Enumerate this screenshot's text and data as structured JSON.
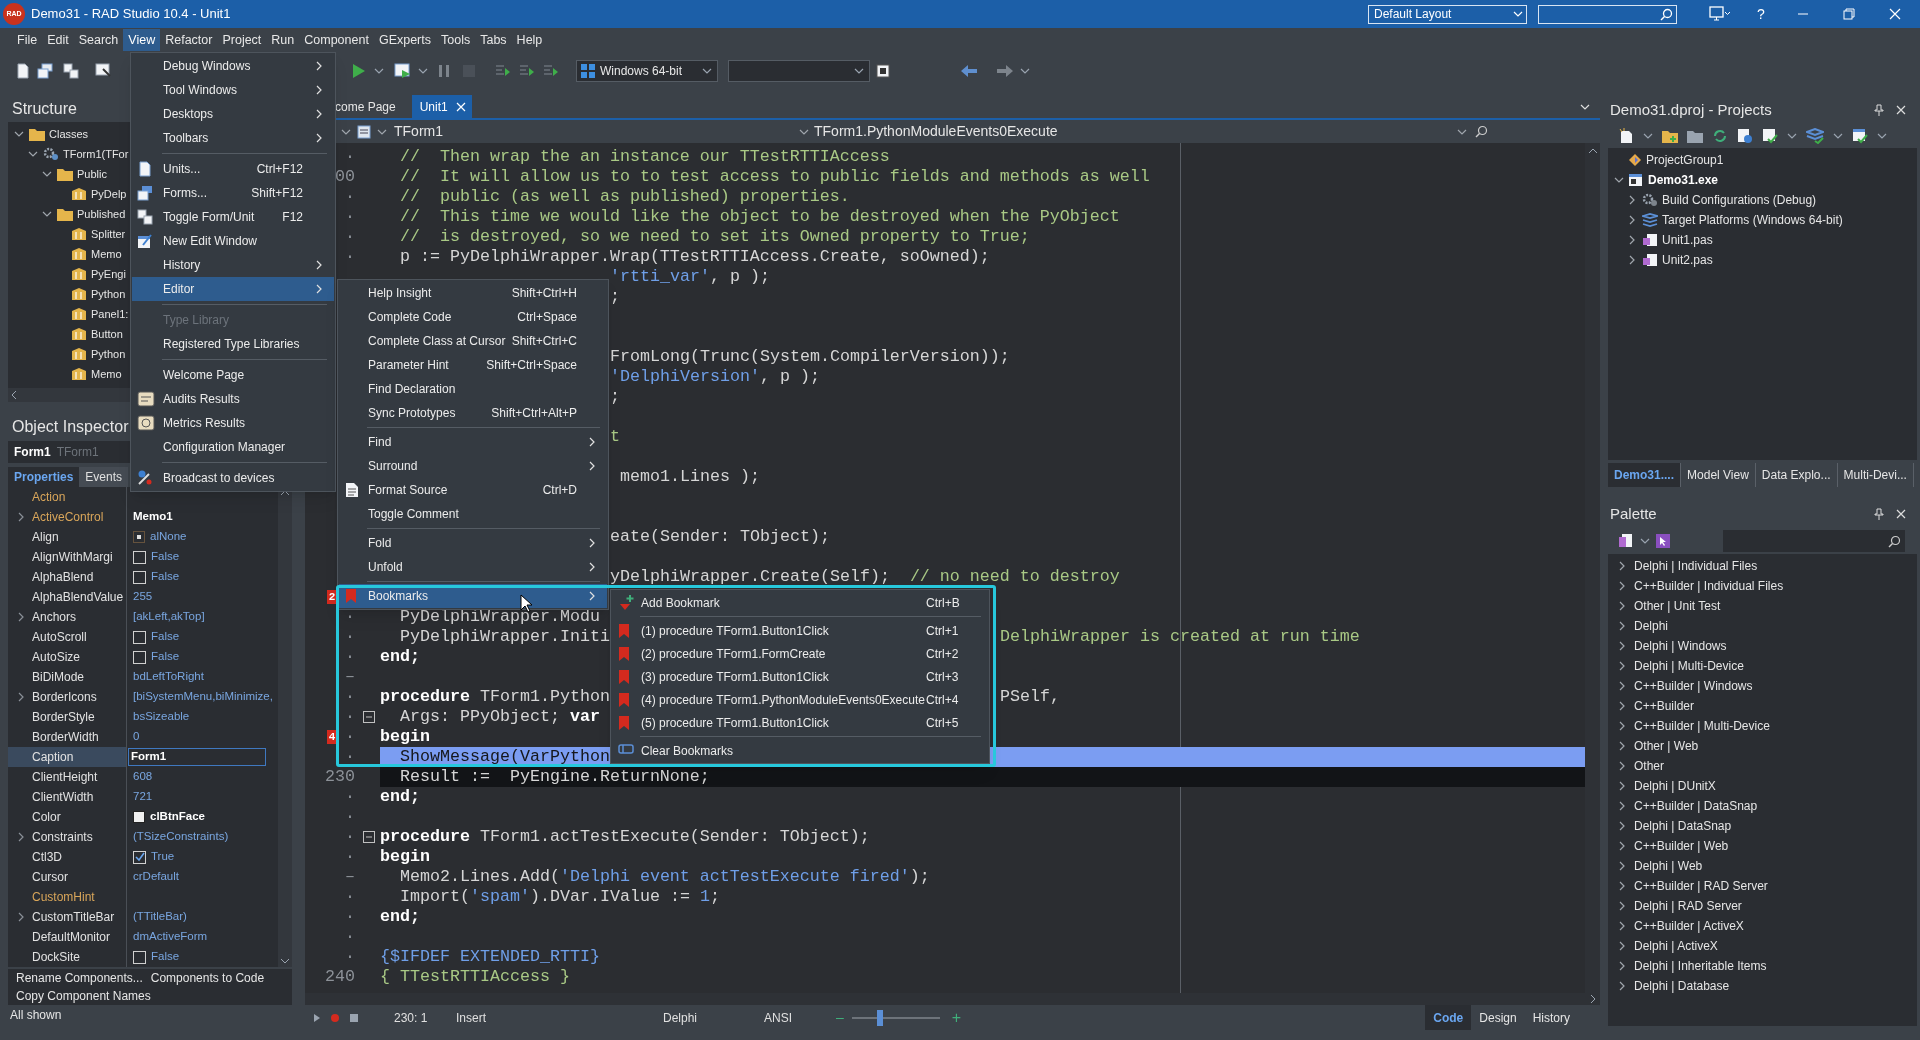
{
  "title_bar": {
    "logo": "RAD",
    "title": "Demo31 - RAD Studio 10.4 - Unit1",
    "layout": "Default Layout",
    "help": "?"
  },
  "menu_bar": [
    {
      "label": "File",
      "selected": false
    },
    {
      "label": "Edit",
      "selected": false
    },
    {
      "label": "Search",
      "selected": false
    },
    {
      "label": "View",
      "selected": true
    },
    {
      "label": "Refactor",
      "selected": false
    },
    {
      "label": "Project",
      "selected": false
    },
    {
      "label": "Run",
      "selected": false
    },
    {
      "label": "Component",
      "selected": false
    },
    {
      "label": "GExperts",
      "selected": false
    },
    {
      "label": "Tools",
      "selected": false
    },
    {
      "label": "Tabs",
      "selected": false
    },
    {
      "label": "Help",
      "selected": false
    }
  ],
  "toolbar": {
    "platform": "Windows 64-bit"
  },
  "structure": {
    "title": "Structure",
    "tree": [
      {
        "label": "Classes",
        "kind": "folder",
        "expanded": true,
        "children": [
          {
            "label": "TForm1(TFor",
            "kind": "class",
            "expanded": true,
            "children": [
              {
                "label": "Public",
                "kind": "folder",
                "expanded": true,
                "children": [
                  {
                    "label": "PyDelp",
                    "kind": "component"
                  }
                ]
              },
              {
                "label": "Published",
                "kind": "folder",
                "expanded": true,
                "children": [
                  {
                    "label": "Splitter",
                    "kind": "component"
                  },
                  {
                    "label": "Memo",
                    "kind": "component"
                  },
                  {
                    "label": "PyEngi",
                    "kind": "component"
                  },
                  {
                    "label": "Python",
                    "kind": "component"
                  },
                  {
                    "label": "Panel1:",
                    "kind": "component"
                  },
                  {
                    "label": "Button",
                    "kind": "component"
                  },
                  {
                    "label": "Python",
                    "kind": "component"
                  },
                  {
                    "label": "Memo",
                    "kind": "component"
                  }
                ]
              }
            ]
          }
        ]
      }
    ]
  },
  "object_inspector": {
    "title": "Object Inspector",
    "object": "Form1",
    "class": "TForm1",
    "tabs": [
      {
        "label": "Properties",
        "selected": true
      },
      {
        "label": "Events",
        "selected": false
      }
    ],
    "properties": [
      {
        "name": "Action",
        "link": true,
        "expandable": false,
        "selected": false,
        "kind": "text"
      },
      {
        "name": "ActiveControl",
        "link": true,
        "expandable": true,
        "selected": false,
        "kind": "text",
        "modified": true,
        "value": "Memo1"
      },
      {
        "name": "Align",
        "link": false,
        "expandable": false,
        "selected": false,
        "kind": "align",
        "modified": false,
        "value": "alNone"
      },
      {
        "name": "AlignWithMargi",
        "link": false,
        "expandable": false,
        "selected": false,
        "kind": "checkbox",
        "checked": false,
        "modified": false,
        "value": "False"
      },
      {
        "name": "AlphaBlend",
        "link": false,
        "expandable": false,
        "selected": false,
        "kind": "checkbox",
        "checked": false,
        "modified": false,
        "value": "False"
      },
      {
        "name": "AlphaBlendValue",
        "link": false,
        "expandable": false,
        "selected": false,
        "kind": "text",
        "modified": false,
        "value": "255"
      },
      {
        "name": "Anchors",
        "link": false,
        "expandable": true,
        "selected": false,
        "kind": "text",
        "modified": false,
        "value": "[akLeft,akTop]"
      },
      {
        "name": "AutoScroll",
        "link": false,
        "expandable": false,
        "selected": false,
        "kind": "checkbox",
        "checked": false,
        "modified": false,
        "value": "False"
      },
      {
        "name": "AutoSize",
        "link": false,
        "expandable": false,
        "selected": false,
        "kind": "checkbox",
        "checked": false,
        "modified": false,
        "value": "False"
      },
      {
        "name": "BiDiMode",
        "link": false,
        "expandable": false,
        "selected": false,
        "kind": "text",
        "modified": false,
        "value": "bdLeftToRight"
      },
      {
        "name": "BorderIcons",
        "link": false,
        "expandable": true,
        "selected": false,
        "kind": "text",
        "modified": false,
        "value": "[biSystemMenu,biMinimize,"
      },
      {
        "name": "BorderStyle",
        "link": false,
        "expandable": false,
        "selected": false,
        "kind": "text",
        "modified": false,
        "value": "bsSizeable"
      },
      {
        "name": "BorderWidth",
        "link": false,
        "expandable": false,
        "selected": false,
        "kind": "text",
        "modified": false,
        "value": "0"
      },
      {
        "name": "Caption",
        "link": false,
        "expandable": false,
        "selected": true,
        "kind": "text",
        "modified": true,
        "value": "Form1"
      },
      {
        "name": "ClientHeight",
        "link": false,
        "expandable": false,
        "selected": false,
        "kind": "text",
        "modified": false,
        "value": "608"
      },
      {
        "name": "ClientWidth",
        "link": false,
        "expandable": false,
        "selected": false,
        "kind": "text",
        "modified": false,
        "value": "721"
      },
      {
        "name": "Color",
        "link": false,
        "expandable": false,
        "selected": false,
        "kind": "color",
        "modified": true,
        "value": "clBtnFace"
      },
      {
        "name": "Constraints",
        "link": false,
        "expandable": true,
        "selected": false,
        "kind": "text",
        "modified": false,
        "value": "(TSizeConstraints)"
      },
      {
        "name": "Ctl3D",
        "link": false,
        "expandable": false,
        "selected": false,
        "kind": "checkbox",
        "checked": true,
        "modified": false,
        "value": "True"
      },
      {
        "name": "Cursor",
        "link": false,
        "expandable": false,
        "selected": false,
        "kind": "text",
        "modified": false,
        "value": "crDefault"
      },
      {
        "name": "CustomHint",
        "link": true,
        "expandable": false,
        "selected": false,
        "kind": "text"
      },
      {
        "name": "CustomTitleBar",
        "link": false,
        "expandable": true,
        "selected": false,
        "kind": "text",
        "modified": false,
        "value": "(TTitleBar)"
      },
      {
        "name": "DefaultMonitor",
        "link": false,
        "expandable": false,
        "selected": false,
        "kind": "text",
        "modified": false,
        "value": "dmActiveForm"
      },
      {
        "name": "DockSite",
        "link": false,
        "expandable": false,
        "selected": false,
        "kind": "checkbox",
        "checked": false,
        "modified": false,
        "value": "False"
      }
    ],
    "commands": [
      [
        "Rename Components...",
        "Components to Code"
      ],
      [
        "Copy Component Names"
      ]
    ],
    "status": "All shown"
  },
  "editor": {
    "tabs": [
      {
        "label": "come Page",
        "selected": false
      },
      {
        "label": "Unit1",
        "selected": true
      }
    ],
    "class_box": "TForm1",
    "method_box": "TForm1.PythonModuleEvents0Execute",
    "lines": [
      {
        "kind": "full",
        "gutter": "·",
        "selected": false,
        "segments": [
          {
            "kind": "comment",
            "text": "  //  Then wrap the an instance our TTestRTTIAccess"
          }
        ]
      },
      {
        "kind": "full",
        "gutter": "00",
        "selected": false,
        "segments": [
          {
            "kind": "comment",
            "text": "  //  It will allow us to to test access to public fields and methods as well"
          }
        ]
      },
      {
        "kind": "full",
        "gutter": "·",
        "selected": false,
        "segments": [
          {
            "kind": "comment",
            "text": "  //  public (as well as published) properties."
          }
        ]
      },
      {
        "kind": "full",
        "gutter": "·",
        "selected": false,
        "segments": [
          {
            "kind": "comment",
            "text": "  //  This time we would like the object to be destroyed when the PyObject"
          }
        ]
      },
      {
        "kind": "full",
        "gutter": "·",
        "selected": false,
        "segments": [
          {
            "kind": "comment",
            "text": "  //  is destroyed, so we need to set its Owned property to True;"
          }
        ]
      },
      {
        "kind": "full",
        "gutter": "·",
        "selected": false,
        "segments": [
          {
            "kind": "plain",
            "text": "  p := PyDelphiWrapper.Wrap(TTestRTTIAccess.Create, soOwned);"
          }
        ]
      },
      {
        "kind": "behind-menu",
        "selected": false,
        "after": [
          {
            "kind": "string",
            "text": "'rtti_var'"
          },
          {
            "kind": "plain",
            "text": ", p );"
          }
        ]
      },
      {
        "kind": "behind-menu",
        "selected": false,
        "after": [
          {
            "kind": "plain",
            "text": ";"
          }
        ]
      },
      {
        "kind": "behind-menu",
        "selected": false
      },
      {
        "kind": "behind-menu",
        "selected": false
      },
      {
        "kind": "behind-menu",
        "selected": false,
        "after": [
          {
            "kind": "plain",
            "text": "FromLong(Trunc(System.CompilerVersion));"
          }
        ]
      },
      {
        "kind": "behind-menu",
        "selected": false,
        "after": [
          {
            "kind": "string",
            "text": "'DelphiVersion'"
          },
          {
            "kind": "plain",
            "text": ", p );"
          }
        ]
      },
      {
        "kind": "behind-menu",
        "selected": false,
        "after": [
          {
            "kind": "plain",
            "text": ";"
          }
        ]
      },
      {
        "kind": "behind-menu",
        "selected": false
      },
      {
        "kind": "behind-menu",
        "selected": false,
        "after": [
          {
            "kind": "comment",
            "text": "t"
          }
        ]
      },
      {
        "kind": "behind-menu",
        "selected": false
      },
      {
        "kind": "behind-menu",
        "selected": false,
        "after": [
          {
            "kind": "plain",
            "text": " memo1.Lines );"
          }
        ]
      },
      {
        "kind": "behind-menu",
        "selected": false
      },
      {
        "kind": "behind-menu",
        "selected": false
      },
      {
        "kind": "behind-menu",
        "selected": false,
        "after": [
          {
            "kind": "plain",
            "text": "eate(Sender: TObject);"
          }
        ]
      },
      {
        "kind": "behind-menu",
        "selected": false
      },
      {
        "kind": "behind-menu",
        "selected": false,
        "after": [
          {
            "kind": "plain",
            "text": "yDelphiWrapper.Create(Self);  "
          },
          {
            "kind": "comment",
            "text": "// no need to destroy"
          }
        ]
      },
      {
        "kind": "behind-menu",
        "selected": false,
        "bookmark": "2"
      },
      {
        "kind": "full",
        "gutter": "·",
        "selected": false,
        "segments": [
          {
            "kind": "plain",
            "text": "  PyDelphiWrapper.Modu"
          }
        ]
      },
      {
        "kind": "split",
        "gutter": "·",
        "selected": false,
        "segments": [
          {
            "kind": "plain",
            "text": "  PyDelphiWrapper.Initi"
          }
        ],
        "after": [
          {
            "kind": "comment",
            "text": "DelphiWrapper is created at run time"
          }
        ]
      },
      {
        "kind": "full",
        "gutter": "·",
        "selected": false,
        "segments": [
          {
            "kind": "keyword",
            "text": "end;"
          }
        ]
      },
      {
        "kind": "full",
        "gutter": "–",
        "selected": false
      },
      {
        "kind": "split",
        "gutter": "·",
        "selected": false,
        "segments": [
          {
            "kind": "keyword",
            "text": "procedure"
          },
          {
            "kind": "plain",
            "text": " TForm1.Python"
          }
        ],
        "after": [
          {
            "kind": "plain",
            "text": "PSelf,"
          }
        ]
      },
      {
        "kind": "full",
        "gutter": "·",
        "selected": false,
        "fold": true,
        "segments": [
          {
            "kind": "plain",
            "text": "  Args: PPyObject; "
          },
          {
            "kind": "keyword",
            "text": "var"
          }
        ]
      },
      {
        "kind": "full",
        "gutter": "·",
        "selected": false,
        "bookmark": "4",
        "segments": [
          {
            "kind": "keyword",
            "text": "begin"
          }
        ]
      },
      {
        "kind": "full",
        "gutter": "·",
        "selected": true,
        "segments": [
          {
            "kind": "plain",
            "text": "  ShowMessage(VarPython"
          }
        ]
      },
      {
        "kind": "full",
        "gutter": "230",
        "selected": false,
        "current": true,
        "segments": [
          {
            "kind": "plain",
            "text": "  Result :=  PyEngine.ReturnNone;"
          }
        ]
      },
      {
        "kind": "full",
        "gutter": "·",
        "selected": false,
        "segments": [
          {
            "kind": "keyword",
            "text": "end;"
          }
        ]
      },
      {
        "kind": "full",
        "gutter": "·",
        "selected": false
      },
      {
        "kind": "full",
        "gutter": "·",
        "selected": false,
        "fold": true,
        "segments": [
          {
            "kind": "keyword",
            "text": "procedure"
          },
          {
            "kind": "plain",
            "text": " TForm1.actTestExecute(Sender: TObject);"
          }
        ]
      },
      {
        "kind": "full",
        "gutter": "·",
        "selected": false,
        "segments": [
          {
            "kind": "keyword",
            "text": "begin"
          }
        ]
      },
      {
        "kind": "full",
        "gutter": "–",
        "selected": false,
        "segments": [
          {
            "kind": "plain",
            "text": "  Memo2.Lines.Add("
          },
          {
            "kind": "string",
            "text": "'Delphi event actTestExecute fired'"
          },
          {
            "kind": "plain",
            "text": ");"
          }
        ]
      },
      {
        "kind": "full",
        "gutter": "·",
        "selected": false,
        "segments": [
          {
            "kind": "plain",
            "text": "  Import("
          },
          {
            "kind": "string",
            "text": "'spam'"
          },
          {
            "kind": "plain",
            "text": ").DVar.IValue := "
          },
          {
            "kind": "number",
            "text": "1"
          },
          {
            "kind": "plain",
            "text": ";"
          }
        ]
      },
      {
        "kind": "full",
        "gutter": "·",
        "selected": false,
        "segments": [
          {
            "kind": "keyword",
            "text": "end;"
          }
        ]
      },
      {
        "kind": "full",
        "gutter": "·",
        "selected": false
      },
      {
        "kind": "full",
        "gutter": "·",
        "selected": false,
        "segments": [
          {
            "kind": "directive",
            "text": "{$IFDEF EXTENDED_RTTI}"
          }
        ]
      },
      {
        "kind": "full",
        "gutter": "240",
        "selected": false,
        "segments": [
          {
            "kind": "comment",
            "text": "{ TTestRTTIAccess }"
          }
        ]
      }
    ]
  },
  "status_bar": {
    "position": "230: 1",
    "mode": "Insert",
    "language": "Delphi",
    "encoding": "ANSI",
    "zoom_out": "–",
    "zoom_in": "+",
    "zoom": {
      "level": 0.32
    },
    "views": [
      {
        "label": "Code",
        "selected": true
      },
      {
        "label": "Design",
        "selected": false
      },
      {
        "label": "History",
        "selected": false
      }
    ]
  },
  "projects": {
    "title": "Demo31.dproj - Projects",
    "tree": [
      {
        "label": "ProjectGroup1",
        "kind": "group",
        "active": false
      },
      {
        "label": "Demo31.exe",
        "kind": "exe",
        "active": true,
        "expanded": true,
        "children": [
          {
            "label": "Build Configurations (Debug)",
            "kind": "config",
            "active": false,
            "expanded": false
          },
          {
            "label": "Target Platforms (Windows 64-bit)",
            "kind": "platforms",
            "active": false,
            "expanded": false
          },
          {
            "label": "Unit1.pas",
            "kind": "unit",
            "active": false,
            "expanded": false
          },
          {
            "label": "Unit2.pas",
            "kind": "unit",
            "active": false,
            "expanded": false
          }
        ]
      }
    ],
    "tabs": [
      {
        "label": "Demo31....",
        "selected": true
      },
      {
        "label": "Model View",
        "selected": false
      },
      {
        "label": "Data Explo...",
        "selected": false
      },
      {
        "label": "Multi-Devi...",
        "selected": false
      }
    ]
  },
  "palette": {
    "title": "Palette",
    "items": [
      {
        "label": "Delphi | Individual Files",
        "expanded": false
      },
      {
        "label": "C++Builder | Individual Files",
        "expanded": false
      },
      {
        "label": "Other | Unit Test",
        "expanded": false
      },
      {
        "label": "Delphi",
        "expanded": false
      },
      {
        "label": "Delphi | Windows",
        "expanded": false
      },
      {
        "label": "Delphi | Multi-Device",
        "expanded": false
      },
      {
        "label": "C++Builder | Windows",
        "expanded": false
      },
      {
        "label": "C++Builder",
        "expanded": false
      },
      {
        "label": "C++Builder | Multi-Device",
        "expanded": false
      },
      {
        "label": "Other | Web",
        "expanded": false
      },
      {
        "label": "Other",
        "expanded": false
      },
      {
        "label": "Delphi | DUnitX",
        "expanded": false
      },
      {
        "label": "C++Builder | DataSnap",
        "expanded": false
      },
      {
        "label": "Delphi | DataSnap",
        "expanded": false
      },
      {
        "label": "C++Builder | Web",
        "expanded": false
      },
      {
        "label": "Delphi | Web",
        "expanded": false
      },
      {
        "label": "C++Builder | RAD Server",
        "expanded": false
      },
      {
        "label": "Delphi | RAD Server",
        "expanded": false
      },
      {
        "label": "C++Builder | ActiveX",
        "expanded": false
      },
      {
        "label": "Delphi | ActiveX",
        "expanded": false
      },
      {
        "label": "Delphi | Inheritable Items",
        "expanded": false
      },
      {
        "label": "Delphi | Database",
        "expanded": false
      }
    ]
  },
  "view_menu": [
    {
      "kind": "item",
      "label": "Debug Windows",
      "submenu": true,
      "selected": false,
      "disabled": false
    },
    {
      "kind": "item",
      "label": "Tool Windows",
      "submenu": true,
      "selected": false,
      "disabled": false
    },
    {
      "kind": "item",
      "label": "Desktops",
      "submenu": true,
      "selected": false,
      "disabled": false
    },
    {
      "kind": "item",
      "label": "Toolbars",
      "submenu": true,
      "selected": false,
      "disabled": false
    },
    {
      "kind": "separator"
    },
    {
      "kind": "item",
      "label": "Units...",
      "shortcut": "Ctrl+F12",
      "submenu": false,
      "selected": false,
      "disabled": false
    },
    {
      "kind": "item",
      "label": "Forms...",
      "shortcut": "Shift+F12",
      "submenu": false,
      "selected": false,
      "disabled": false
    },
    {
      "kind": "item",
      "label": "Toggle Form/Unit",
      "shortcut": "F12",
      "submenu": false,
      "selected": false,
      "disabled": false
    },
    {
      "kind": "item",
      "label": "New Edit Window",
      "submenu": false,
      "selected": false,
      "disabled": false
    },
    {
      "kind": "item",
      "label": "History",
      "submenu": true,
      "selected": false,
      "disabled": false
    },
    {
      "kind": "item",
      "label": "Editor",
      "submenu": true,
      "selected": true,
      "disabled": false
    },
    {
      "kind": "separator"
    },
    {
      "kind": "item",
      "label": "Type Library",
      "submenu": false,
      "selected": false,
      "disabled": true
    },
    {
      "kind": "item",
      "label": "Registered Type Libraries",
      "submenu": false,
      "selected": false,
      "disabled": false
    },
    {
      "kind": "separator"
    },
    {
      "kind": "item",
      "label": "Welcome Page",
      "submenu": false,
      "selected": false,
      "disabled": false
    },
    {
      "kind": "item",
      "label": "Audits Results",
      "submenu": false,
      "selected": false,
      "disabled": false
    },
    {
      "kind": "item",
      "label": "Metrics Results",
      "submenu": false,
      "selected": false,
      "disabled": false
    },
    {
      "kind": "item",
      "label": "Configuration Manager",
      "submenu": false,
      "selected": false,
      "disabled": false
    },
    {
      "kind": "separator"
    },
    {
      "kind": "item",
      "label": "Broadcast to devices",
      "submenu": false,
      "selected": false,
      "disabled": false
    }
  ],
  "editor_menu": [
    {
      "kind": "item",
      "label": "Help Insight",
      "shortcut": "Shift+Ctrl+H",
      "submenu": false,
      "selected": false,
      "disabled": false
    },
    {
      "kind": "item",
      "label": "Complete Code",
      "shortcut": "Ctrl+Space",
      "submenu": false,
      "selected": false,
      "disabled": false
    },
    {
      "kind": "item",
      "label": "Complete Class at Cursor",
      "shortcut": "Shift+Ctrl+C",
      "submenu": false,
      "selected": false,
      "disabled": false
    },
    {
      "kind": "item",
      "label": "Parameter Hint",
      "shortcut": "Shift+Ctrl+Space",
      "submenu": false,
      "selected": false,
      "disabled": false
    },
    {
      "kind": "item",
      "label": "Find Declaration",
      "submenu": false,
      "selected": false,
      "disabled": false
    },
    {
      "kind": "item",
      "label": "Sync Prototypes",
      "shortcut": "Shift+Ctrl+Alt+P",
      "submenu": false,
      "selected": false,
      "disabled": false
    },
    {
      "kind": "separator"
    },
    {
      "kind": "item",
      "label": "Find",
      "submenu": true,
      "selected": false,
      "disabled": false
    },
    {
      "kind": "item",
      "label": "Surround",
      "submenu": true,
      "selected": false,
      "disabled": false
    },
    {
      "kind": "item",
      "label": "Format Source",
      "shortcut": "Ctrl+D",
      "submenu": false,
      "selected": false,
      "disabled": false
    },
    {
      "kind": "item",
      "label": "Toggle Comment",
      "submenu": false,
      "selected": false,
      "disabled": false
    },
    {
      "kind": "separator"
    },
    {
      "kind": "item",
      "label": "Fold",
      "submenu": true,
      "selected": false,
      "disabled": false
    },
    {
      "kind": "item",
      "label": "Unfold",
      "submenu": true,
      "selected": false,
      "disabled": false
    },
    {
      "kind": "separator"
    },
    {
      "kind": "item",
      "label": "Bookmarks",
      "submenu": true,
      "selected": true,
      "disabled": false
    }
  ],
  "bookmarks_menu": [
    {
      "kind": "item",
      "label": "Add Bookmark",
      "shortcut": "Ctrl+B",
      "submenu": false,
      "selected": false,
      "disabled": false
    },
    {
      "kind": "separator"
    },
    {
      "kind": "item",
      "label": "(1) procedure TForm1.Button1Click",
      "shortcut": "Ctrl+1",
      "submenu": false,
      "selected": false,
      "disabled": false
    },
    {
      "kind": "item",
      "label": "(2) procedure TForm1.FormCreate",
      "shortcut": "Ctrl+2",
      "submenu": false,
      "selected": false,
      "disabled": false
    },
    {
      "kind": "item",
      "label": "(3) procedure TForm1.Button1Click",
      "shortcut": "Ctrl+3",
      "submenu": false,
      "selected": false,
      "disabled": false
    },
    {
      "kind": "item",
      "label": "(4) procedure TForm1.PythonModuleEvents0Execute",
      "shortcut": "Ctrl+4",
      "submenu": false,
      "selected": false,
      "disabled": false
    },
    {
      "kind": "item",
      "label": "(5) procedure TForm1.Button1Click",
      "shortcut": "Ctrl+5",
      "submenu": false,
      "selected": false,
      "disabled": false
    },
    {
      "kind": "separator"
    },
    {
      "kind": "item",
      "label": "Clear Bookmarks",
      "submenu": false,
      "selected": false,
      "disabled": false
    }
  ]
}
